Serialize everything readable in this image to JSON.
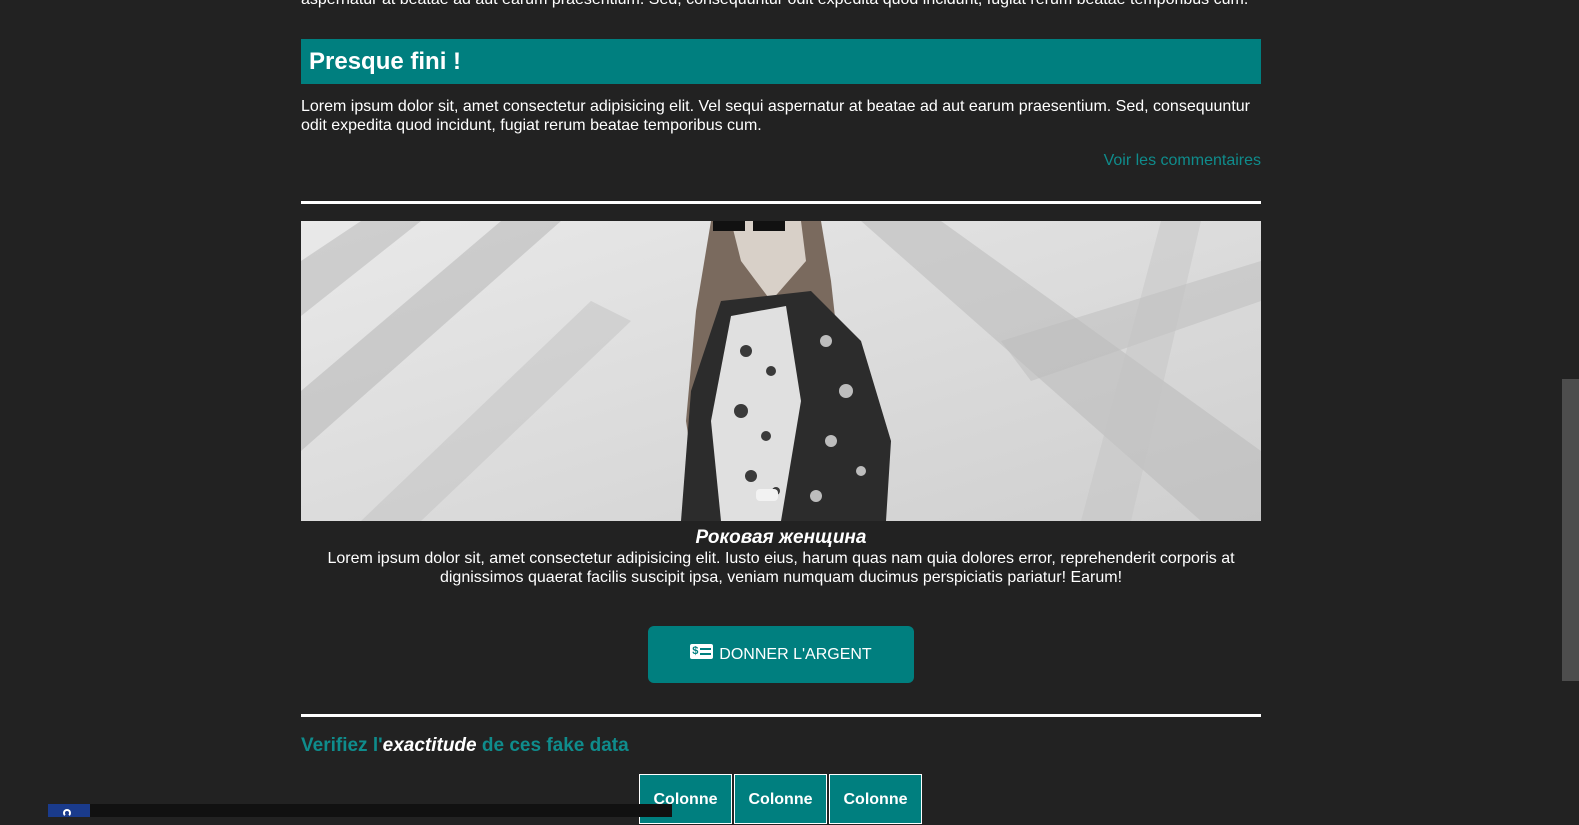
{
  "cut_paragraph": "aspernatur at beatae ad aut earum praesentium. Sed, consequuntur odit expedita quod incidunt, fugiat rerum beatae temporibus cum.",
  "section": {
    "title": "Presque fini !",
    "body": "Lorem ipsum dolor sit, amet consectetur adipisicing elit. Vel sequi aspernatur at beatae ad aut earum praesentium. Sed, consequuntur odit expedita quod incidunt, fugiat rerum beatae temporibus cum.",
    "comments_link": "Voir les commentaires"
  },
  "figure": {
    "caption_title": "Роковая женщина",
    "caption_text": "Lorem ipsum dolor sit, amet consectetur adipisicing elit. Iusto eius, harum quas nam quia dolores error, reprehenderit corporis at dignissimos quaerat facilis suscipit ipsa, veniam numquam ducimus perspiciatis pariatur! Earum!"
  },
  "donate": {
    "icon": "money-bill-icon",
    "label": "DONNER L'ARGENT"
  },
  "verify": {
    "prefix": "Verifiez l'",
    "emphasis": "exactitude",
    "suffix": " de ces fake data"
  },
  "table": {
    "headers": [
      "Colonne",
      "Colonne",
      "Colonne"
    ]
  },
  "colors": {
    "accent": "#007f7f",
    "link": "#0f8c8c",
    "background": "#222222"
  }
}
